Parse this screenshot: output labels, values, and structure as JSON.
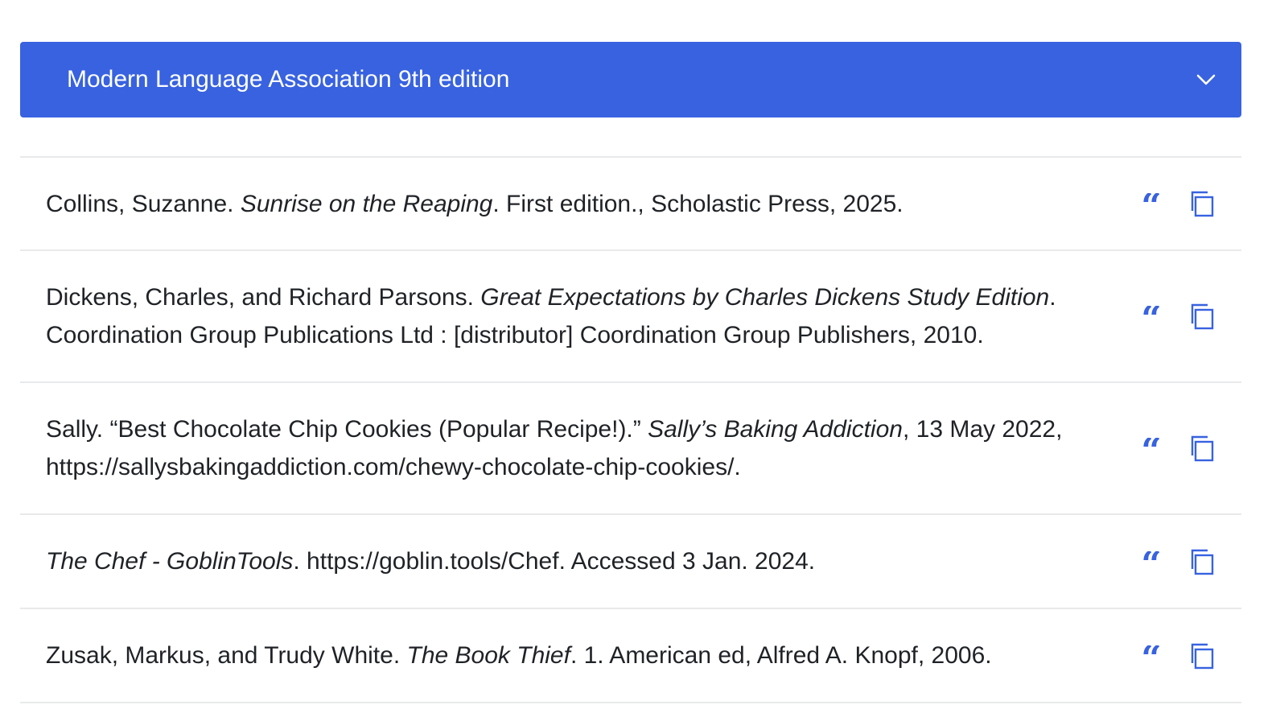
{
  "style_selector": {
    "label": "Modern Language Association 9th edition",
    "icon": "chevron-down-icon"
  },
  "citations": [
    {
      "parts": [
        {
          "text": "Collins, Suzanne. ",
          "italic": false
        },
        {
          "text": "Sunrise on the Reaping",
          "italic": true
        },
        {
          "text": ". First edition., Scholastic Press, 2025.",
          "italic": false
        }
      ]
    },
    {
      "parts": [
        {
          "text": "Dickens, Charles, and Richard Parsons. ",
          "italic": false
        },
        {
          "text": "Great Expectations by Charles Dickens Study Edition",
          "italic": true
        },
        {
          "text": ". Coordination Group Publications Ltd : [distributor] Coordination Group Publishers, 2010.",
          "italic": false
        }
      ]
    },
    {
      "parts": [
        {
          "text": "Sally. “Best Chocolate Chip Cookies (Popular Recipe!).” ",
          "italic": false
        },
        {
          "text": "Sally’s Baking Addiction",
          "italic": true
        },
        {
          "text": ", 13 May 2022, https://sallysbakingaddiction.com/chewy-chocolate-chip-cookies/.",
          "italic": false
        }
      ]
    },
    {
      "parts": [
        {
          "text": "The Chef - GoblinTools",
          "italic": true
        },
        {
          "text": ". https://goblin.tools/Chef. Accessed 3 Jan. 2024.",
          "italic": false
        }
      ]
    },
    {
      "parts": [
        {
          "text": "Zusak, Markus, and Trudy White. ",
          "italic": false
        },
        {
          "text": "The Book Thief",
          "italic": true
        },
        {
          "text": ". 1. American ed, Alfred A. Knopf, 2006.",
          "italic": false
        }
      ]
    }
  ],
  "row_actions": {
    "quote_icon": "quote-icon",
    "copy_icon": "copy-icon"
  },
  "colors": {
    "accent": "#3862e0",
    "icon": "#3862e0",
    "divider": "#e8e9eb",
    "text": "#1f2226"
  }
}
